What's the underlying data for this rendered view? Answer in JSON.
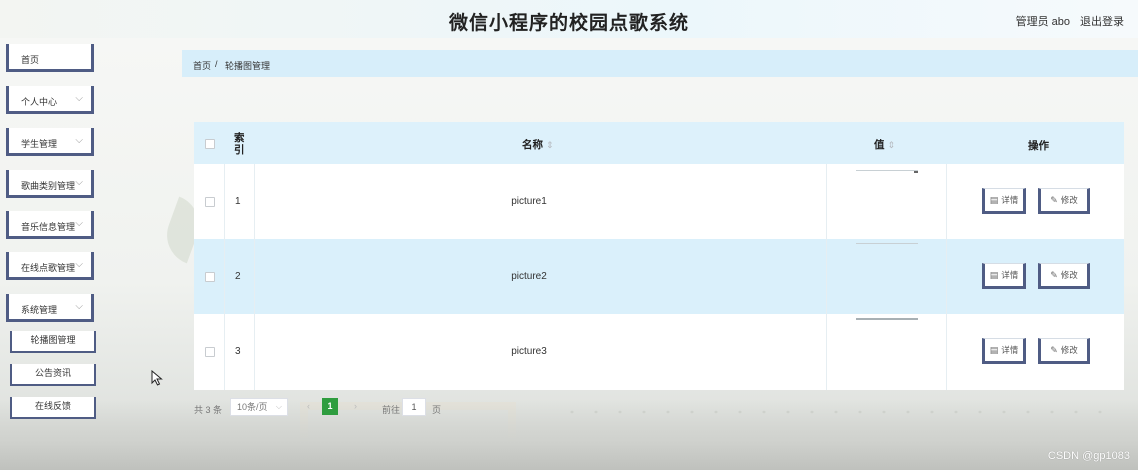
{
  "header": {
    "title": "微信小程序的校园点歌系统",
    "user_label": "管理员 abo",
    "logout_label": "退出登录"
  },
  "sidebar": {
    "items": [
      {
        "label": "首页",
        "has_chevron": false
      },
      {
        "label": "个人中心",
        "has_chevron": true
      },
      {
        "label": "学生管理",
        "has_chevron": true
      },
      {
        "label": "歌曲类别管理",
        "has_chevron": true
      },
      {
        "label": "音乐信息管理",
        "has_chevron": true
      },
      {
        "label": "在线点歌管理",
        "has_chevron": true
      },
      {
        "label": "系统管理",
        "has_chevron": true
      }
    ],
    "subitems": [
      {
        "label": "轮播图管理"
      },
      {
        "label": "公告资讯"
      },
      {
        "label": "在线反馈"
      }
    ],
    "chevron_glyph": "⌵"
  },
  "breadcrumb": {
    "home": "首页",
    "separator": "/",
    "current": "轮播图管理"
  },
  "table": {
    "columns": {
      "index": "索引",
      "name": "名称",
      "value": "值",
      "actions": "操作"
    },
    "sort_icon": "⇕",
    "rows": [
      {
        "index": "1",
        "name": "picture1"
      },
      {
        "index": "2",
        "name": "picture2"
      },
      {
        "index": "3",
        "name": "picture3"
      }
    ],
    "detail_label": "详情",
    "edit_label": "修改"
  },
  "pagination": {
    "total": "共 3 条",
    "page_size": "10条/页",
    "current_page": "1",
    "goto_label": "前往",
    "goto_value": "1",
    "page_unit": "页"
  },
  "watermark": "CSDN @gp1083",
  "colors": {
    "accent_border": "#4f5c84",
    "table_header_bg": "#ddf1fb",
    "highlight_row_bg": "#daf0fb",
    "pager_active": "#2f9d3f"
  }
}
